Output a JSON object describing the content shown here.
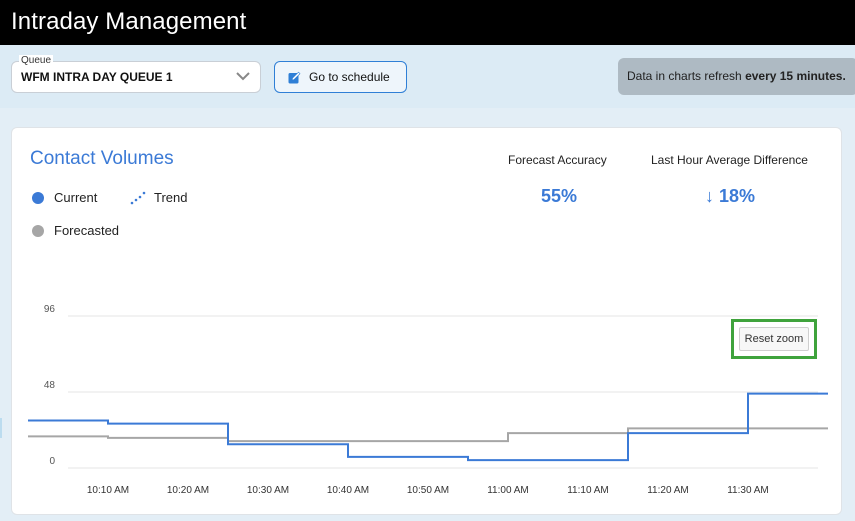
{
  "app": {
    "title": "Intraday Management"
  },
  "toolbar": {
    "queue_label": "Queue",
    "queue_value": "WFM INTRA DAY QUEUE 1",
    "schedule_button": "Go to schedule",
    "refresh_prefix": "Data in charts refresh ",
    "refresh_interval": "every 15 minutes."
  },
  "card": {
    "title": "Contact Volumes",
    "legend": {
      "current": "Current",
      "trend": "Trend",
      "forecasted": "Forecasted"
    },
    "kpis": {
      "forecast_accuracy_label": "Forecast Accuracy",
      "forecast_accuracy_value": "55%",
      "last_hour_label": "Last Hour Average Difference",
      "last_hour_value": "↓ 18%"
    },
    "reset_zoom": "Reset zoom"
  },
  "colors": {
    "current": "#3b7ad6",
    "forecasted": "#a6a6a6",
    "accent": "#3b7ad6",
    "highlight": "#3fa33c"
  },
  "chart_data": {
    "type": "line",
    "step": true,
    "y_ticks": [
      "96",
      "48",
      "0"
    ],
    "ylim": [
      0,
      96
    ],
    "x_ticks": [
      "10:10 AM",
      "10:20 AM",
      "10:30 AM",
      "10:40 AM",
      "10:50 AM",
      "11:00 AM",
      "11:10 AM",
      "11:20 AM",
      "11:30 AM"
    ],
    "x_start": "10:00 AM",
    "x_end": "11:40 AM",
    "grid": true,
    "series": [
      {
        "name": "Current",
        "times": [
          "10:00 AM",
          "10:10 AM",
          "10:25 AM",
          "10:40 AM",
          "10:55 AM",
          "11:15 AM",
          "11:30 AM",
          "11:40 AM"
        ],
        "values": [
          30,
          28,
          15,
          7,
          5,
          22,
          47,
          47
        ]
      },
      {
        "name": "Forecasted",
        "times": [
          "10:00 AM",
          "10:10 AM",
          "10:25 AM",
          "11:00 AM",
          "11:15 AM",
          "11:40 AM"
        ],
        "values": [
          20,
          19,
          17,
          22,
          25,
          25
        ]
      }
    ]
  }
}
